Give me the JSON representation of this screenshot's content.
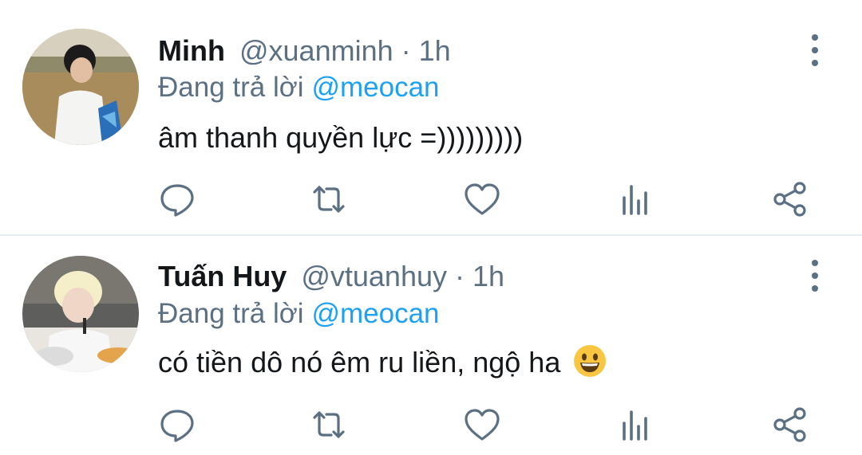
{
  "tweets": [
    {
      "name": "Minh",
      "handle": "@xuanminh",
      "separator": "·",
      "time": "1h",
      "reply_prefix": "Đang trả lời",
      "reply_to": "@meocan",
      "text": "âm thanh quyền lực =)))))))))",
      "emoji": ""
    },
    {
      "name": "Tuấn Huy",
      "handle": "@vtuanhuy",
      "separator": "·",
      "time": "1h",
      "reply_prefix": "Đang trả lời",
      "reply_to": "@meocan",
      "text": "có tiền dô nó êm ru liền, ngộ ha",
      "emoji": "grinning-face"
    }
  ],
  "actions": [
    "reply-icon",
    "retweet-icon",
    "like-icon",
    "analytics-icon",
    "share-icon"
  ],
  "colors": {
    "text_primary": "#14171a",
    "text_secondary": "#5b7083",
    "link": "#1da1f2",
    "divider": "#e6ecf0"
  }
}
